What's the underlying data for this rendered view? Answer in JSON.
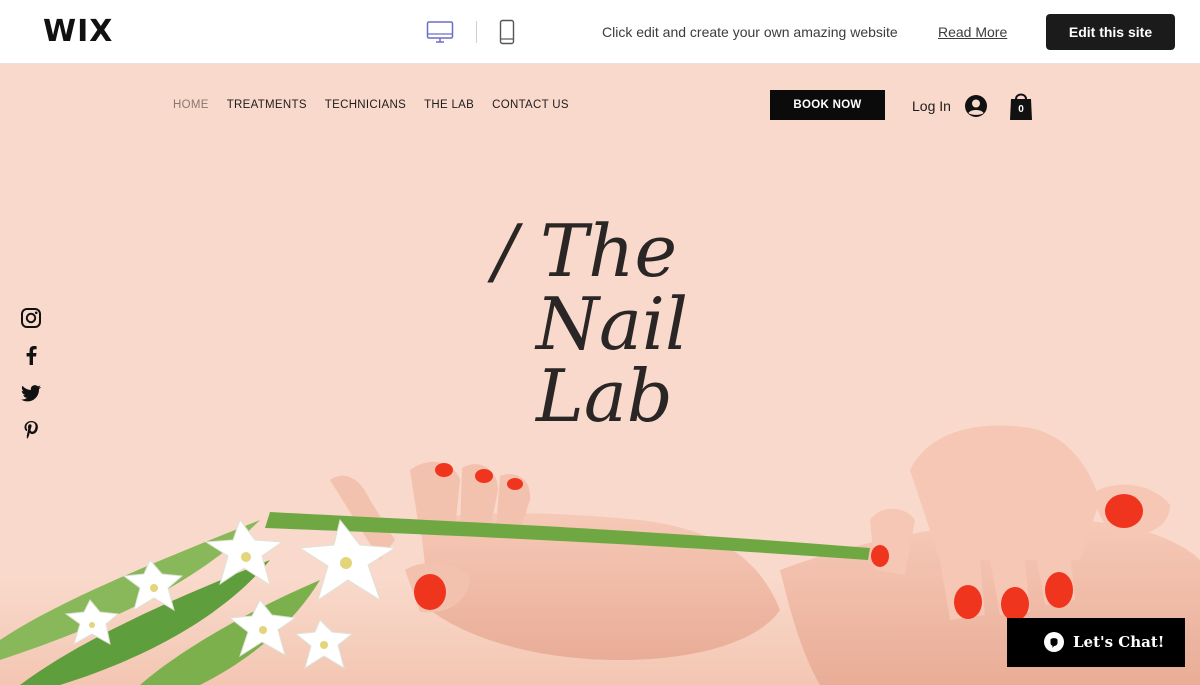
{
  "wix_bar": {
    "logo": "WIX",
    "message": "Click edit and create your own amazing website",
    "read_more": "Read More",
    "edit_button": "Edit this site",
    "device_icons": [
      "desktop-icon",
      "mobile-icon"
    ]
  },
  "header": {
    "nav": [
      {
        "label": "HOME",
        "active": true
      },
      {
        "label": "TREATMENTS",
        "active": false
      },
      {
        "label": "TECHNICIANS",
        "active": false
      },
      {
        "label": "THE LAB",
        "active": false
      },
      {
        "label": "CONTACT US",
        "active": false
      }
    ],
    "book_button": "BOOK NOW",
    "login": "Log In",
    "cart_count": "0"
  },
  "hero": {
    "title_lines": [
      "/ The",
      "Nail",
      "Lab"
    ]
  },
  "social_icons": [
    "instagram-icon",
    "facebook-icon",
    "twitter-icon",
    "pinterest-icon"
  ],
  "chat": {
    "label": "Let's Chat!"
  },
  "colors": {
    "background": "#f9d9cb",
    "accent_nail": "#f0351f",
    "button_dark": "#0b0b0b"
  }
}
